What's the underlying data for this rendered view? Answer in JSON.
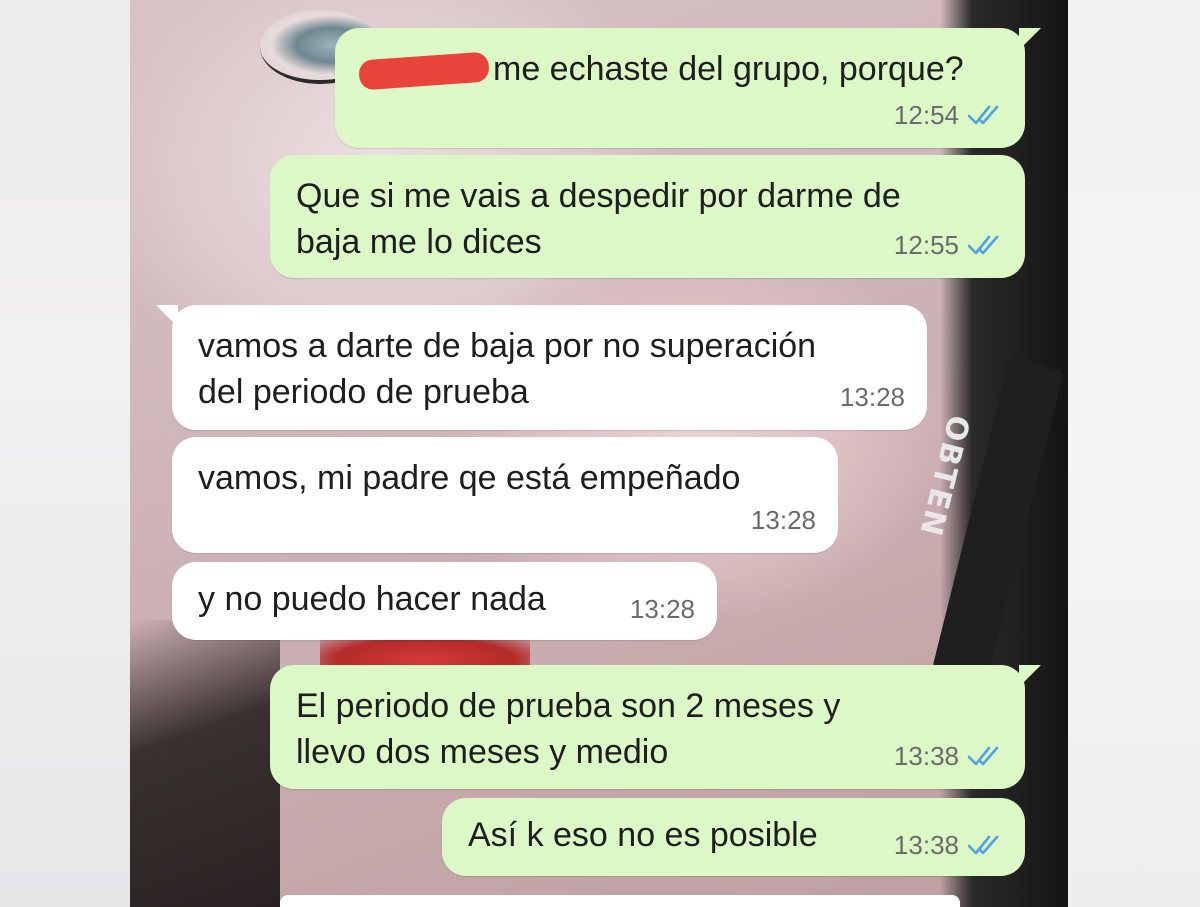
{
  "conversation": {
    "messages": [
      {
        "id": "m1",
        "direction": "sent",
        "text": "me echaste del grupo, porque?",
        "time": "12:54",
        "status": "read",
        "redacted_prefix": true
      },
      {
        "id": "m2",
        "direction": "sent",
        "text": "Que si me vais a despedir por darme de\nbaja me lo dices",
        "time": "12:55",
        "status": "read"
      },
      {
        "id": "m3",
        "direction": "received",
        "text": "vamos a darte de baja por no superación\ndel periodo de prueba",
        "time": "13:28"
      },
      {
        "id": "m4",
        "direction": "received",
        "text": "vamos, mi padre qe está empeñado",
        "time": "13:28"
      },
      {
        "id": "m5",
        "direction": "received",
        "text": "y no puedo hacer nada",
        "time": "13:28"
      },
      {
        "id": "m6",
        "direction": "sent",
        "text": "El periodo de prueba son 2 meses y\nllevo dos meses y medio",
        "time": "13:38",
        "status": "read"
      },
      {
        "id": "m7",
        "direction": "sent",
        "text": "Así k eso no es posible",
        "time": "13:38",
        "status": "read"
      }
    ]
  },
  "wallpaper": {
    "strap_text": "OBTEN"
  },
  "colors": {
    "sent_bubble": "#dcf8c6",
    "received_bubble": "#ffffff",
    "read_ticks": "#4fa3e0",
    "timestamp": "#6b6b6b",
    "redaction": "#e8443a"
  },
  "icons": {
    "read_receipt": "double-check-icon"
  }
}
